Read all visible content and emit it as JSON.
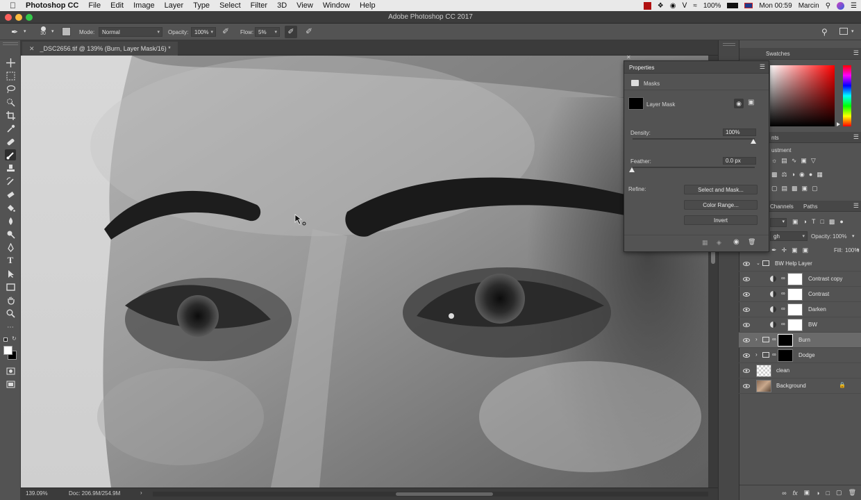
{
  "menubar": {
    "app_name": "Photoshop CC",
    "items": [
      "File",
      "Edit",
      "Image",
      "Layer",
      "Type",
      "Select",
      "Filter",
      "3D",
      "View",
      "Window",
      "Help"
    ],
    "battery": "100%",
    "clock": "Mon 00:59",
    "user": "Marcin"
  },
  "window": {
    "title": "Adobe Photoshop CC 2017"
  },
  "options_bar": {
    "brush_size": "30",
    "mode_label": "Mode:",
    "mode_value": "Normal",
    "opacity_label": "Opacity:",
    "opacity_value": "100%",
    "flow_label": "Flow:",
    "flow_value": "5%"
  },
  "document": {
    "tab_title": "_DSC2656.tif @ 139% (Burn, Layer Mask/16) *",
    "zoom": "139.09%",
    "doc_size": "Doc: 206.9M/254.9M"
  },
  "properties": {
    "title": "Properties",
    "section": "Masks",
    "mask_type": "Layer Mask",
    "density_label": "Density:",
    "density_value": "100%",
    "density_level": 1.0,
    "feather_label": "Feather:",
    "feather_value": "0.0 px",
    "feather_level": 0.0,
    "refine_label": "Refine:",
    "buttons": [
      "Select and Mask...",
      "Color Range...",
      "Invert"
    ]
  },
  "dock": {
    "swatches_tab": "Swatches",
    "adjustments_tab_partial": "nts",
    "adjustment_label_partial": "ustment",
    "channels_tab": "Channels",
    "paths_tab": "Paths",
    "blend_partial": "gh",
    "opacity_label": "Opacity:",
    "opacity_value": "100%",
    "fill_label": "Fill:",
    "fill_value": "100%"
  },
  "layers": [
    {
      "name": "BW Help Layer",
      "kind": "group-open"
    },
    {
      "name": "Contrast copy",
      "kind": "adjustment"
    },
    {
      "name": "Contrast",
      "kind": "adjustment"
    },
    {
      "name": "Darken",
      "kind": "adjustment"
    },
    {
      "name": "BW",
      "kind": "adjustment"
    },
    {
      "name": "Burn",
      "kind": "group-mask",
      "selected": true
    },
    {
      "name": "Dodge",
      "kind": "group-mask"
    },
    {
      "name": "clean",
      "kind": "empty"
    },
    {
      "name": "Background",
      "kind": "image",
      "locked": true
    }
  ],
  "colors": {
    "panel_bg": "#535353",
    "canvas_dark": "#282828",
    "selected_layer": "#6a6a6a",
    "foreground_color": "#ffffff",
    "background_color": "#000000"
  }
}
